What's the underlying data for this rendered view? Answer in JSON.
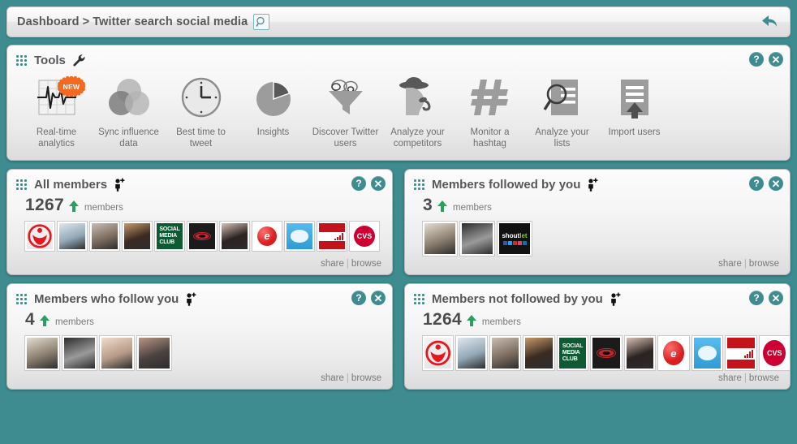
{
  "breadcrumb": {
    "root": "Dashboard",
    "separator": ">",
    "current": "Twitter search social media",
    "search_icon": "magnifier-icon",
    "undo_icon": "back-arrow-icon"
  },
  "tools_panel": {
    "title": "Tools",
    "title_icon": "wrench-icon",
    "help_label": "?",
    "close_label": "✕",
    "tools": [
      {
        "label": "Real-time analytics",
        "icon": "ecg-chart-icon",
        "badge": "NEW"
      },
      {
        "label": "Sync influence data",
        "icon": "venn-circles-icon",
        "badge": ""
      },
      {
        "label": "Best time to tweet",
        "icon": "clock-icon",
        "badge": ""
      },
      {
        "label": "Insights",
        "icon": "pie-chart-icon",
        "badge": ""
      },
      {
        "label": "Discover Twitter users",
        "icon": "funnel-icon",
        "badge": ""
      },
      {
        "label": "Analyze your competitors",
        "icon": "detective-icon",
        "badge": ""
      },
      {
        "label": "Monitor a hashtag",
        "icon": "hashtag-icon",
        "badge": ""
      },
      {
        "label": "Analyze your lists",
        "icon": "document-magnifier-icon",
        "badge": ""
      },
      {
        "label": "Import users",
        "icon": "document-upload-icon",
        "badge": ""
      }
    ]
  },
  "panels": [
    {
      "title": "All members",
      "title_icon": "person-plus-icon",
      "count": "1267",
      "count_unit": "members",
      "trend": "up",
      "share_label": "share",
      "browse_label": "browse",
      "help_label": "?",
      "close_label": "✕",
      "avatars": [
        {
          "name": "red-charity-logo",
          "bg": "#ffffff",
          "fg": "#e8161c",
          "glyph": "⚱"
        },
        {
          "name": "man-blue-shirt-photo",
          "bg": "#93a9b8",
          "fg": "#dfe7ec",
          "glyph": ""
        },
        {
          "name": "father-and-child-photo",
          "bg": "#7e6e62",
          "fg": "#c9bdb2",
          "glyph": ""
        },
        {
          "name": "man-in-crowd-photo",
          "bg": "#3b2b23",
          "fg": "#c79a6a",
          "glyph": ""
        },
        {
          "name": "social-media-club-logo",
          "bg": "#0f5a33",
          "fg": "#ffffff",
          "glyph": "SOCIAL MEDIA CLUB"
        },
        {
          "name": "red-eye-photo",
          "bg": "#1b1b1b",
          "fg": "#c4262c",
          "glyph": ""
        },
        {
          "name": "dark-hair-woman-photo",
          "bg": "#2b2322",
          "fg": "#d7c0b4",
          "glyph": ""
        },
        {
          "name": "red-sphere-logo",
          "bg": "#ffffff",
          "fg": "#d81e20",
          "glyph": "e"
        },
        {
          "name": "salesforce-cloud-logo",
          "bg": "#3ba9e0",
          "fg": "#ffffff",
          "glyph": ""
        },
        {
          "name": "red-stripes-chart-logo",
          "bg": "#ffffff",
          "fg": "#c4141b",
          "glyph": ""
        },
        {
          "name": "cvs-pharmacy-logo",
          "bg": "#ffffff",
          "fg": "#cc0033",
          "glyph": "CVS"
        }
      ]
    },
    {
      "title": "Members followed by you",
      "title_icon": "person-plus-icon",
      "count": "3",
      "count_unit": "members",
      "trend": "up",
      "share_label": "share",
      "browse_label": "browse",
      "help_label": "?",
      "close_label": "✕",
      "avatars": [
        {
          "name": "man-outdoors-photo",
          "bg": "#8c8070",
          "fg": "#e3ddd2",
          "glyph": ""
        },
        {
          "name": "man-in-suit-photo",
          "bg": "#9a9a9a",
          "fg": "#2d2d2d",
          "glyph": ""
        },
        {
          "name": "shoutlet-logo",
          "bg": "#111111",
          "fg": "#ffffff",
          "glyph": "shoutlet"
        }
      ]
    },
    {
      "title": "Members who follow you",
      "title_icon": "person-plus-icon",
      "count": "4",
      "count_unit": "members",
      "trend": "up",
      "share_label": "share",
      "browse_label": "browse",
      "help_label": "?",
      "close_label": "✕",
      "avatars": [
        {
          "name": "man-outdoors-photo",
          "bg": "#8c8070",
          "fg": "#e3ddd2",
          "glyph": ""
        },
        {
          "name": "man-in-suit-photo",
          "bg": "#9a9a9a",
          "fg": "#2d2d2d",
          "glyph": ""
        },
        {
          "name": "couple-photo",
          "bg": "#b79b88",
          "fg": "#f0dcca",
          "glyph": ""
        },
        {
          "name": "woman-dark-background-photo",
          "bg": "#4a4340",
          "fg": "#b89585",
          "glyph": ""
        }
      ]
    },
    {
      "title": "Members not followed by you",
      "title_icon": "person-plus-icon",
      "count": "1264",
      "count_unit": "members",
      "trend": "up",
      "share_label": "share",
      "browse_label": "browse",
      "help_label": "?",
      "close_label": "✕",
      "avatars": [
        {
          "name": "red-charity-logo",
          "bg": "#ffffff",
          "fg": "#e8161c",
          "glyph": "⚱"
        },
        {
          "name": "man-blue-shirt-photo",
          "bg": "#93a9b8",
          "fg": "#dfe7ec",
          "glyph": ""
        },
        {
          "name": "father-and-child-photo",
          "bg": "#7e6e62",
          "fg": "#c9bdb2",
          "glyph": ""
        },
        {
          "name": "man-in-crowd-photo",
          "bg": "#3b2b23",
          "fg": "#c79a6a",
          "glyph": ""
        },
        {
          "name": "social-media-club-logo",
          "bg": "#0f5a33",
          "fg": "#ffffff",
          "glyph": "SOCIAL MEDIA CLUB"
        },
        {
          "name": "red-eye-photo",
          "bg": "#1b1b1b",
          "fg": "#c4262c",
          "glyph": ""
        },
        {
          "name": "dark-hair-woman-photo",
          "bg": "#2b2322",
          "fg": "#d7c0b4",
          "glyph": ""
        },
        {
          "name": "red-sphere-logo",
          "bg": "#ffffff",
          "fg": "#d81e20",
          "glyph": "e"
        },
        {
          "name": "salesforce-cloud-logo",
          "bg": "#3ba9e0",
          "fg": "#ffffff",
          "glyph": ""
        },
        {
          "name": "red-stripes-chart-logo",
          "bg": "#ffffff",
          "fg": "#c4141b",
          "glyph": ""
        },
        {
          "name": "cvs-pharmacy-logo",
          "bg": "#ffffff",
          "fg": "#cc0033",
          "glyph": "CVS"
        }
      ]
    }
  ],
  "colors": {
    "background_teal": "#3e8c90",
    "accent_teal": "#3e8c90",
    "trend_green": "#2aa05e",
    "badge_orange": "#f26a21",
    "text_dark": "#55575a",
    "text_muted": "#78797b"
  }
}
